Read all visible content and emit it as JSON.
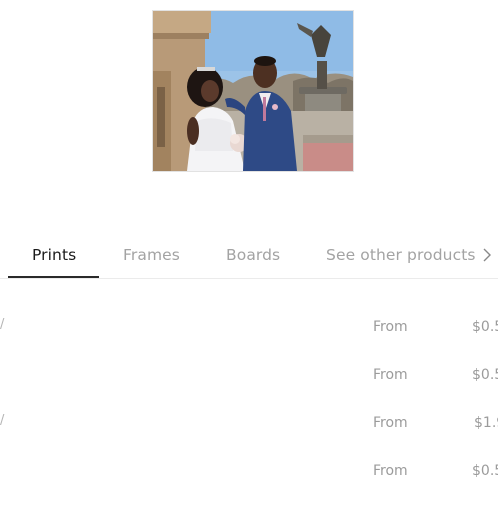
{
  "photo": {
    "subject": "wedding-couple-photo"
  },
  "tabs": [
    {
      "label": "Prints",
      "active": true
    },
    {
      "label": "Frames",
      "active": false
    },
    {
      "label": "Boards",
      "active": false
    },
    {
      "label": "See other products",
      "active": false
    }
  ],
  "rows": [
    {
      "edge": "/",
      "from": "From",
      "price": "$0.5"
    },
    {
      "edge": "",
      "from": "From",
      "price": "$0.5"
    },
    {
      "edge": "/",
      "from": "From",
      "price": "$1.9"
    },
    {
      "edge": "",
      "from": "From",
      "price": "$0.5"
    }
  ],
  "colors": {
    "active_tab": "#1b1b1b",
    "inactive_tab": "#a3a3a3",
    "muted_text": "#9b9b9b"
  }
}
